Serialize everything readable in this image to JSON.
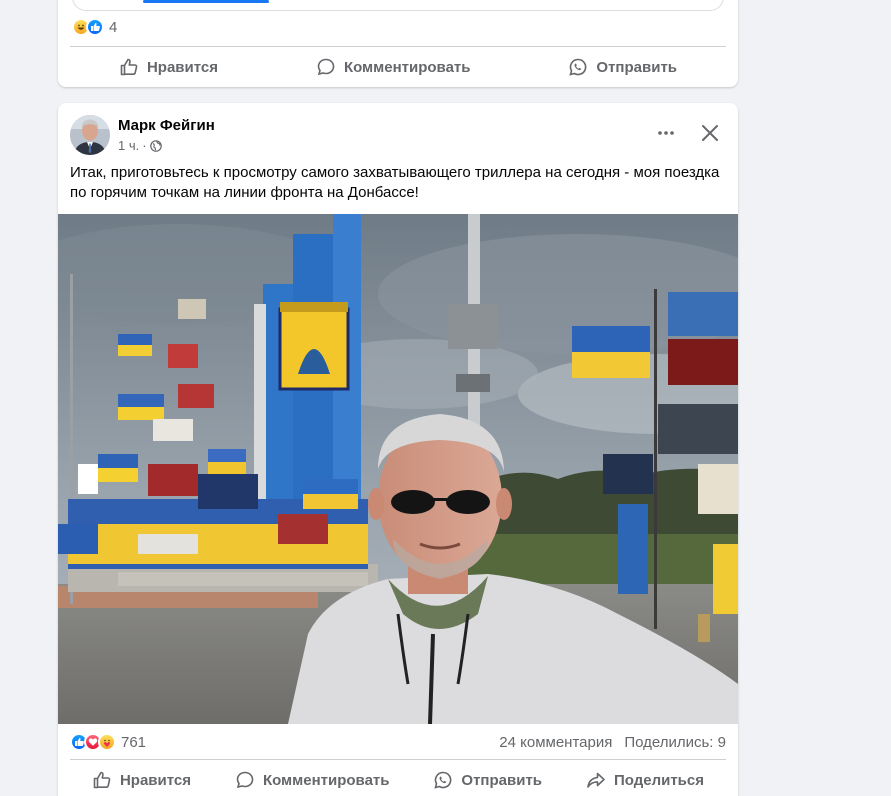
{
  "prev_post": {
    "reaction_count": "4",
    "actions": {
      "like": "Нравится",
      "comment": "Комментировать",
      "send": "Отправить"
    }
  },
  "post": {
    "author": "Марк Фейгин",
    "time": "1 ч.",
    "separator": "·",
    "text": "Итак, приготовьтесь к просмотру самого захватывающего триллера на сегодня - моя поездка по горячим точкам на линии фронта на Донбассе!",
    "reaction_count": "761",
    "comments_count": "24 комментария",
    "shares_count": "Поделились: 9",
    "actions": {
      "like": "Нравится",
      "comment": "Комментировать",
      "send": "Отправить",
      "share": "Поделиться"
    }
  },
  "colors": {
    "accent": "#1877f2",
    "secondary_text": "#65676b",
    "background": "#f0f2f5"
  },
  "icons": [
    "like-icon",
    "comment-icon",
    "whatsapp-send-icon",
    "share-icon",
    "more-icon",
    "close-icon",
    "globe-icon"
  ]
}
